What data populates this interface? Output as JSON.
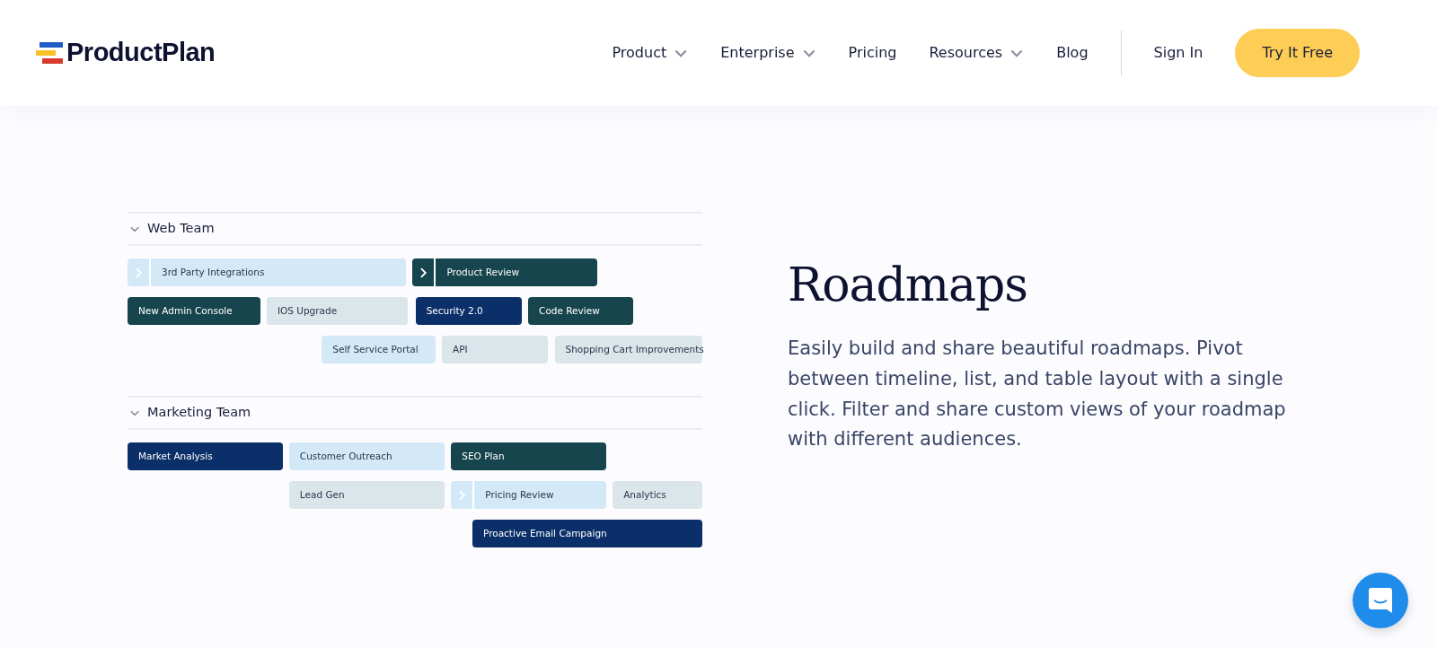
{
  "header": {
    "logo": "ProductPlan",
    "nav": [
      {
        "label": "Product",
        "kind": "dropdown"
      },
      {
        "label": "Enterprise",
        "kind": "dropdown"
      },
      {
        "label": "Pricing",
        "kind": "link"
      },
      {
        "label": "Resources",
        "kind": "dropdown"
      },
      {
        "label": "Blog",
        "kind": "link"
      }
    ],
    "sign_in": "Sign In",
    "cta": "Try It Free"
  },
  "roadmap": {
    "teams": [
      {
        "name": "Web Team",
        "expanded": true,
        "bars": [
          {
            "label": "3rd Party Integrations",
            "color": "#d3e9f8",
            "kind": "expandable"
          },
          {
            "label": "Product Review",
            "color": "#17454d",
            "kind": "expandable"
          },
          {
            "label": "New Admin Console",
            "color": "#17454d",
            "kind": "plain"
          },
          {
            "label": "IOS Upgrade",
            "color": "#dbe6ea",
            "kind": "plain"
          },
          {
            "label": "Security 2.0",
            "color": "#0b2f68",
            "kind": "plain"
          },
          {
            "label": "Code Review",
            "color": "#17454d",
            "kind": "plain"
          },
          {
            "label": "Self Service Portal",
            "color": "#d3e9f8",
            "kind": "plain"
          },
          {
            "label": "API",
            "color": "#dbe6ea",
            "kind": "plain"
          },
          {
            "label": "Shopping Cart Improvements",
            "color": "#dbe6ea",
            "kind": "plain"
          }
        ]
      },
      {
        "name": "Marketing Team",
        "expanded": true,
        "bars": [
          {
            "label": "Market Analysis",
            "color": "#0b2f68",
            "kind": "plain"
          },
          {
            "label": "Customer Outreach",
            "color": "#d3e9f8",
            "kind": "plain"
          },
          {
            "label": "SEO Plan",
            "color": "#17454d",
            "kind": "plain"
          },
          {
            "label": "Lead Gen",
            "color": "#dbe6ea",
            "kind": "plain"
          },
          {
            "label": "Pricing Review",
            "color": "#d3e9f8",
            "kind": "expandable"
          },
          {
            "label": "Analytics",
            "color": "#dbe6ea",
            "kind": "plain"
          },
          {
            "label": "Proactive Email Campaign",
            "color": "#0b2f68",
            "kind": "plain"
          }
        ]
      }
    ]
  },
  "feature": {
    "title": "Roadmaps",
    "body": "Easily build and share beautiful roadmaps. Pivot between timeline, list, and table layout with a single click. Filter and share custom views of your roadmap with different audiences."
  }
}
